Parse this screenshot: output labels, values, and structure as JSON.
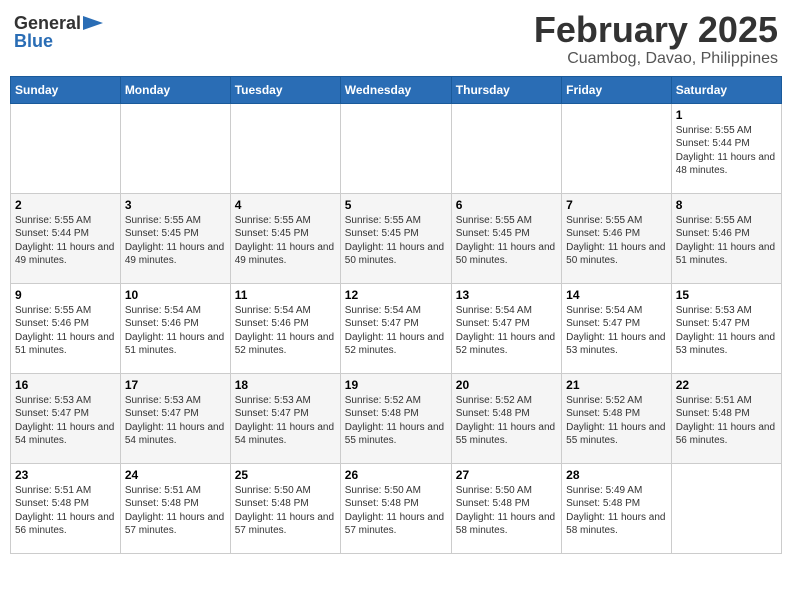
{
  "header": {
    "logo_general": "General",
    "logo_blue": "Blue",
    "month_year": "February 2025",
    "location": "Cuambog, Davao, Philippines"
  },
  "weekdays": [
    "Sunday",
    "Monday",
    "Tuesday",
    "Wednesday",
    "Thursday",
    "Friday",
    "Saturday"
  ],
  "weeks": [
    [
      {
        "day": "",
        "info": ""
      },
      {
        "day": "",
        "info": ""
      },
      {
        "day": "",
        "info": ""
      },
      {
        "day": "",
        "info": ""
      },
      {
        "day": "",
        "info": ""
      },
      {
        "day": "",
        "info": ""
      },
      {
        "day": "1",
        "info": "Sunrise: 5:55 AM\nSunset: 5:44 PM\nDaylight: 11 hours and 48 minutes."
      }
    ],
    [
      {
        "day": "2",
        "info": "Sunrise: 5:55 AM\nSunset: 5:44 PM\nDaylight: 11 hours and 49 minutes."
      },
      {
        "day": "3",
        "info": "Sunrise: 5:55 AM\nSunset: 5:45 PM\nDaylight: 11 hours and 49 minutes."
      },
      {
        "day": "4",
        "info": "Sunrise: 5:55 AM\nSunset: 5:45 PM\nDaylight: 11 hours and 49 minutes."
      },
      {
        "day": "5",
        "info": "Sunrise: 5:55 AM\nSunset: 5:45 PM\nDaylight: 11 hours and 50 minutes."
      },
      {
        "day": "6",
        "info": "Sunrise: 5:55 AM\nSunset: 5:45 PM\nDaylight: 11 hours and 50 minutes."
      },
      {
        "day": "7",
        "info": "Sunrise: 5:55 AM\nSunset: 5:46 PM\nDaylight: 11 hours and 50 minutes."
      },
      {
        "day": "8",
        "info": "Sunrise: 5:55 AM\nSunset: 5:46 PM\nDaylight: 11 hours and 51 minutes."
      }
    ],
    [
      {
        "day": "9",
        "info": "Sunrise: 5:55 AM\nSunset: 5:46 PM\nDaylight: 11 hours and 51 minutes."
      },
      {
        "day": "10",
        "info": "Sunrise: 5:54 AM\nSunset: 5:46 PM\nDaylight: 11 hours and 51 minutes."
      },
      {
        "day": "11",
        "info": "Sunrise: 5:54 AM\nSunset: 5:46 PM\nDaylight: 11 hours and 52 minutes."
      },
      {
        "day": "12",
        "info": "Sunrise: 5:54 AM\nSunset: 5:47 PM\nDaylight: 11 hours and 52 minutes."
      },
      {
        "day": "13",
        "info": "Sunrise: 5:54 AM\nSunset: 5:47 PM\nDaylight: 11 hours and 52 minutes."
      },
      {
        "day": "14",
        "info": "Sunrise: 5:54 AM\nSunset: 5:47 PM\nDaylight: 11 hours and 53 minutes."
      },
      {
        "day": "15",
        "info": "Sunrise: 5:53 AM\nSunset: 5:47 PM\nDaylight: 11 hours and 53 minutes."
      }
    ],
    [
      {
        "day": "16",
        "info": "Sunrise: 5:53 AM\nSunset: 5:47 PM\nDaylight: 11 hours and 54 minutes."
      },
      {
        "day": "17",
        "info": "Sunrise: 5:53 AM\nSunset: 5:47 PM\nDaylight: 11 hours and 54 minutes."
      },
      {
        "day": "18",
        "info": "Sunrise: 5:53 AM\nSunset: 5:47 PM\nDaylight: 11 hours and 54 minutes."
      },
      {
        "day": "19",
        "info": "Sunrise: 5:52 AM\nSunset: 5:48 PM\nDaylight: 11 hours and 55 minutes."
      },
      {
        "day": "20",
        "info": "Sunrise: 5:52 AM\nSunset: 5:48 PM\nDaylight: 11 hours and 55 minutes."
      },
      {
        "day": "21",
        "info": "Sunrise: 5:52 AM\nSunset: 5:48 PM\nDaylight: 11 hours and 55 minutes."
      },
      {
        "day": "22",
        "info": "Sunrise: 5:51 AM\nSunset: 5:48 PM\nDaylight: 11 hours and 56 minutes."
      }
    ],
    [
      {
        "day": "23",
        "info": "Sunrise: 5:51 AM\nSunset: 5:48 PM\nDaylight: 11 hours and 56 minutes."
      },
      {
        "day": "24",
        "info": "Sunrise: 5:51 AM\nSunset: 5:48 PM\nDaylight: 11 hours and 57 minutes."
      },
      {
        "day": "25",
        "info": "Sunrise: 5:50 AM\nSunset: 5:48 PM\nDaylight: 11 hours and 57 minutes."
      },
      {
        "day": "26",
        "info": "Sunrise: 5:50 AM\nSunset: 5:48 PM\nDaylight: 11 hours and 57 minutes."
      },
      {
        "day": "27",
        "info": "Sunrise: 5:50 AM\nSunset: 5:48 PM\nDaylight: 11 hours and 58 minutes."
      },
      {
        "day": "28",
        "info": "Sunrise: 5:49 AM\nSunset: 5:48 PM\nDaylight: 11 hours and 58 minutes."
      },
      {
        "day": "",
        "info": ""
      }
    ]
  ]
}
